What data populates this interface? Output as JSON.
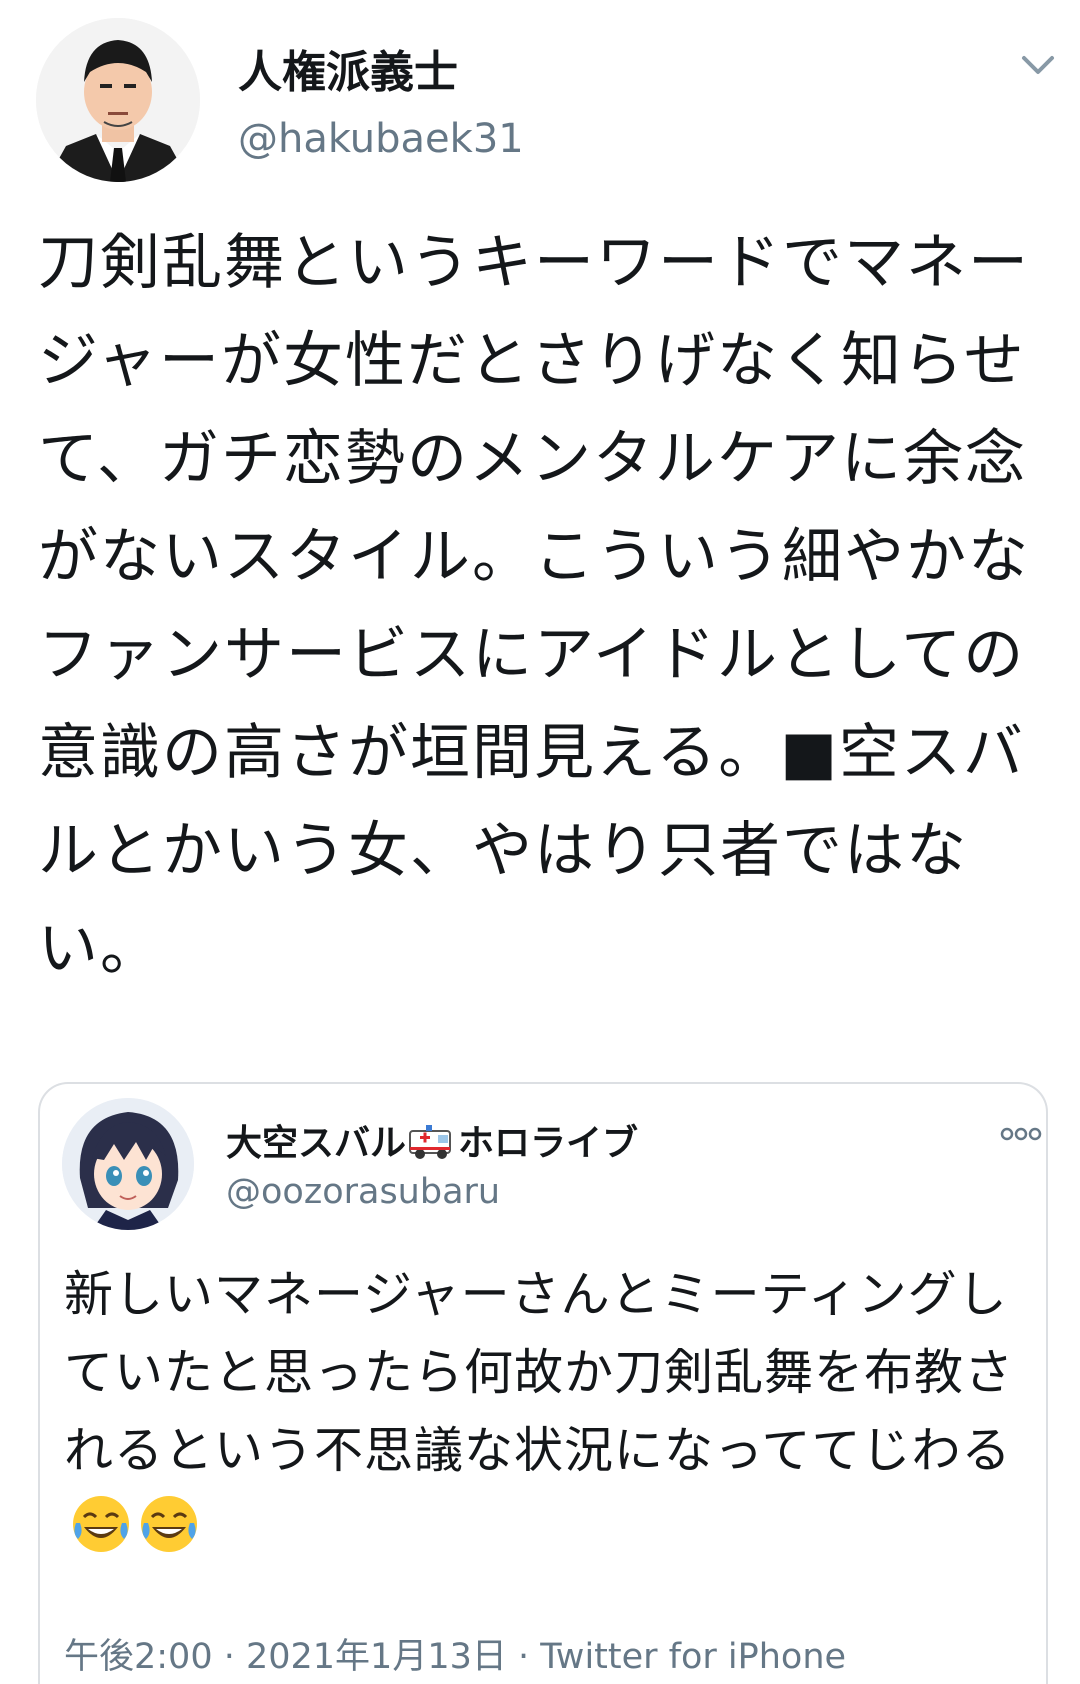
{
  "author": {
    "display_name": "人権派義士",
    "handle": "@hakubaek31",
    "avatar_icon": "man-portrait-avatar"
  },
  "header": {
    "menu_icon": "chevron-down-icon"
  },
  "tweet": {
    "text": "刀剣乱舞というキーワードでマネージャーが女性だとさりげなく知らせて、ガチ恋勢のメンタルケアに余念がないスタイル。こういう細やかなファンサービスにアイドルとしての意識の高さが垣間見える。■空スバルとかいう女、やはり只者ではない。"
  },
  "quote": {
    "name_part1": "大空スバル",
    "name_emoji": "ambulance-icon",
    "name_part2": "ホロライブ",
    "handle": "@oozorasubaru",
    "more_icon": "more-options-icon",
    "text": "新しいマネージャーさんとミーティングしていたと思ったら何故か刀剣乱舞を布教されるという不思議な状況になっててじわる",
    "emojis": [
      "crying-laughing-emoji",
      "crying-laughing-emoji"
    ],
    "meta": "午後2:00 · 2021年1月13日 · Twitter for iPhone"
  },
  "colors": {
    "text_primary": "#14171a",
    "text_secondary": "#657786",
    "border": "#dcdfe3"
  }
}
